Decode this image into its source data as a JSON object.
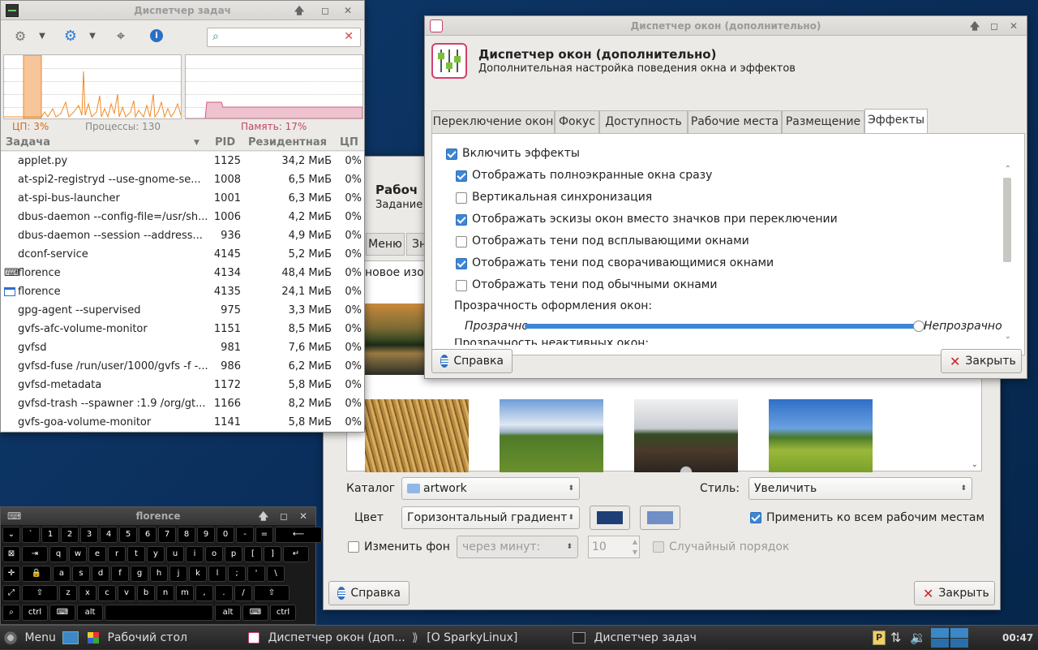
{
  "colors": {
    "accent": "#3d86d6",
    "cpu": "#f08a24",
    "mem": "#d05a7a",
    "desktop": "#0b2f5c"
  },
  "taskmgr": {
    "title": "Диспетчер задач",
    "cpu_label": "ЦП: 3%",
    "proc_label": "Процессы: 130",
    "mem_label": "Память: 17%",
    "columns": [
      "Задача",
      "PID",
      "Резидентная",
      "ЦП"
    ],
    "rows": [
      {
        "name": "applet.py",
        "pid": "1125",
        "rss": "34,2 МиБ",
        "cpu": "0%"
      },
      {
        "name": "at-spi2-registryd --use-gnome-se...",
        "pid": "1008",
        "rss": "6,5 МиБ",
        "cpu": "0%"
      },
      {
        "name": "at-spi-bus-launcher",
        "pid": "1001",
        "rss": "6,3 МиБ",
        "cpu": "0%"
      },
      {
        "name": "dbus-daemon --config-file=/usr/sh...",
        "pid": "1006",
        "rss": "4,2 МиБ",
        "cpu": "0%"
      },
      {
        "name": "dbus-daemon --session --address...",
        "pid": "936",
        "rss": "4,9 МиБ",
        "cpu": "0%"
      },
      {
        "name": "dconf-service",
        "pid": "4145",
        "rss": "5,2 МиБ",
        "cpu": "0%"
      },
      {
        "name": "florence",
        "pid": "4134",
        "rss": "48,4 МиБ",
        "cpu": "0%",
        "icon": "keyboard-icon"
      },
      {
        "name": "florence",
        "pid": "4135",
        "rss": "24,1 МиБ",
        "cpu": "0%",
        "icon": "window-icon"
      },
      {
        "name": "gpg-agent --supervised",
        "pid": "975",
        "rss": "3,3 МиБ",
        "cpu": "0%"
      },
      {
        "name": "gvfs-afc-volume-monitor",
        "pid": "1151",
        "rss": "8,5 МиБ",
        "cpu": "0%"
      },
      {
        "name": "gvfsd",
        "pid": "981",
        "rss": "7,6 МиБ",
        "cpu": "0%"
      },
      {
        "name": "gvfsd-fuse /run/user/1000/gvfs -f -...",
        "pid": "986",
        "rss": "6,2 МиБ",
        "cpu": "0%"
      },
      {
        "name": "gvfsd-metadata",
        "pid": "1172",
        "rss": "5,8 МиБ",
        "cpu": "0%"
      },
      {
        "name": "gvfsd-trash --spawner :1.9 /org/gt...",
        "pid": "1166",
        "rss": "8,2 МиБ",
        "cpu": "0%"
      },
      {
        "name": "gvfs-goa-volume-monitor",
        "pid": "1141",
        "rss": "5,8 МиБ",
        "cpu": "0%"
      }
    ]
  },
  "wallpaper": {
    "title_partial": "Рабоч",
    "subtitle_partial": "Задание",
    "tab_partial_1": "Меню",
    "tab_partial_2": "Зн",
    "images_label": "новое изоб",
    "folder_label": "Каталог",
    "folder_value": "artwork",
    "style_label": "Стиль:",
    "style_value": "Увеличить",
    "color_label": "Цвет",
    "color_value": "Горизонтальный градиент",
    "color1": "#1d3f78",
    "color2": "#6f8fc6",
    "apply_all": "Применить ко всем рабочим местам",
    "change_bg": "Изменить фон",
    "interval": "через минут:",
    "interval_value": "10",
    "random": "Случайный порядок",
    "help": "Справка",
    "close": "Закрыть"
  },
  "wmtweaks": {
    "title": "Диспетчер окон (дополнительно)",
    "heading": "Диспетчер окон (дополнительно)",
    "subheading": "Дополнительная настройка поведения окна и эффектов",
    "tabs": [
      "Переключение окон",
      "Фокус",
      "Доступность",
      "Рабочие места",
      "Размещение",
      "Эффекты"
    ],
    "enable_effects": "Включить эффекты",
    "options": [
      {
        "label": "Отображать полноэкранные окна сразу",
        "checked": true
      },
      {
        "label": "Вертикальная синхронизация",
        "checked": false
      },
      {
        "label": "Отображать эскизы окон вместо значков при переключении",
        "checked": true
      },
      {
        "label": "Отображать тени под всплывающими окнами",
        "checked": false
      },
      {
        "label": "Отображать тени под сворачивающимися окнами",
        "checked": true
      },
      {
        "label": "Отображать тени под обычными окнами",
        "checked": false
      }
    ],
    "opacity_label": "Прозрачность оформления окон:",
    "slider_left": "Прозрачно",
    "slider_right": "Непрозрачно",
    "slider_value": 1.0,
    "inactive_label": "Прозрачность неактивных окон:",
    "help": "Справка",
    "close": "Закрыть"
  },
  "florence": {
    "title": "florence"
  },
  "taskbar": {
    "menu": "Menu",
    "items": [
      "Рабочий стол",
      "Диспетчер окон (доп...",
      "[O SparkyLinux]",
      "Диспетчер задач"
    ],
    "clock": "00:47"
  }
}
